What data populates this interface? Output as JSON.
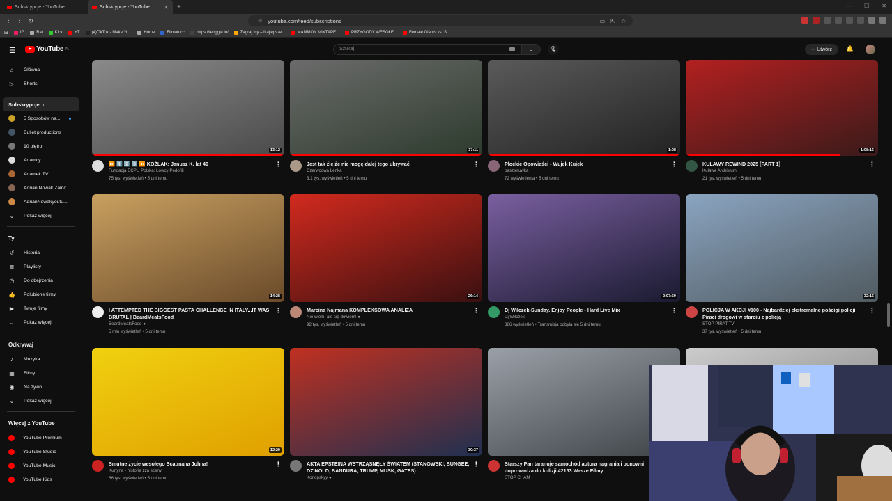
{
  "browser": {
    "tabs": [
      {
        "title": "Subskrypcje - YouTube",
        "active": false
      },
      {
        "title": "Subskrypcje - YouTube",
        "active": true
      }
    ],
    "url": "youtube.com/feed/subscriptions",
    "bookmarks": [
      "IG",
      "Rat",
      "Kick",
      "YT",
      "(4)TikTok - Make Yo...",
      "Home",
      "Filman.cc",
      "https://tenggle.io/",
      "Zagraj.my – Najlepsze...",
      "MAMMON MIXTAPE...",
      "PRZYGODY WESOŁE...",
      "Female Giants vs. St..."
    ]
  },
  "header": {
    "logo_text": "YouTube",
    "logo_sup": "PL",
    "search_placeholder": "Szukaj",
    "create_label": "Utwórz"
  },
  "sidebar": {
    "main": [
      {
        "label": "Główna",
        "icon": "home-icon"
      },
      {
        "label": "Shorts",
        "icon": "shorts-icon"
      }
    ],
    "subs_header": "Subskrypcje",
    "channels": [
      {
        "label": "5 Sposobów na...",
        "color": "#c9a227",
        "new": true
      },
      {
        "label": "Bullet productions",
        "color": "#445566",
        "new": false
      },
      {
        "label": "10 piętro",
        "color": "#777777",
        "new": false
      },
      {
        "label": "Adamcy",
        "color": "#dddddd",
        "new": false
      },
      {
        "label": "Adamek TV",
        "color": "#aa6633",
        "new": false
      },
      {
        "label": "Adrian Nowak Żałno",
        "color": "#886655",
        "new": false
      },
      {
        "label": "AdrianNowakyoutu...",
        "color": "#cc8844",
        "new": false
      }
    ],
    "more_label": "Pokaż więcej",
    "you_header": "Ty",
    "you": [
      {
        "label": "Historia",
        "icon": "history-icon"
      },
      {
        "label": "Playlisty",
        "icon": "playlist-icon"
      },
      {
        "label": "Do obejrzenia",
        "icon": "watch-later-icon"
      },
      {
        "label": "Polubione filmy",
        "icon": "like-icon"
      },
      {
        "label": "Twoje filmy",
        "icon": "your-videos-icon"
      },
      {
        "label": "Pokaż więcej",
        "icon": "chevron-down-icon"
      }
    ],
    "explore_header": "Odkrywaj",
    "explore": [
      {
        "label": "Muzyka",
        "icon": "music-icon"
      },
      {
        "label": "Filmy",
        "icon": "film-icon"
      },
      {
        "label": "Na żywo",
        "icon": "live-icon"
      },
      {
        "label": "Pokaż więcej",
        "icon": "chevron-down-icon"
      }
    ],
    "more_yt_header": "Więcej z YouTube",
    "more_yt": [
      {
        "label": "YouTube Premium"
      },
      {
        "label": "YouTube Studio"
      },
      {
        "label": "YouTube Music"
      },
      {
        "label": "YouTube Kids"
      }
    ]
  },
  "videos": [
    {
      "title": "⏩ 1️⃣ 2️⃣ 3️⃣ ⏪ KOŹLAK: Janusz K. lat 49",
      "channel": "Fundacja ECPU Polska: Łowcy Pedofili",
      "stats": "75 tys. wyświetleń • 5 dni temu",
      "duration": "13:12",
      "verified": false,
      "progress": 1.0,
      "colors": [
        "#8a8a8a",
        "#4a4a4a"
      ],
      "avatar": "#dddddd"
    },
    {
      "title": "Jest tak źle że nie mogę dalej tego ukrywać",
      "channel": "Czerwcowa Lenka",
      "stats": "3,1 tys. wyświetleń • 5 dni temu",
      "duration": "37:11",
      "verified": false,
      "progress": 1.0,
      "colors": [
        "#6b6b6b",
        "#2d3b2d"
      ],
      "avatar": "#aa9988"
    },
    {
      "title": "Płockie Opowieści - Wujek Kujek",
      "channel": "pasztetuwka",
      "stats": "72 wyświetlenia • 5 dni temu",
      "duration": "1:08",
      "verified": false,
      "progress": 1.0,
      "colors": [
        "#5a5a5a",
        "#222222"
      ],
      "avatar": "#886677"
    },
    {
      "title": "KULAWY REWIND 2025 [PART 1]",
      "channel": "Kulawe Archiwum",
      "stats": "21 tys. wyświetleń • 5 dni temu",
      "duration": "1:08:16",
      "verified": false,
      "progress": 0.8,
      "colors": [
        "#b32020",
        "#3a1a1a"
      ],
      "avatar": "#335544"
    },
    {
      "title": "I ATTEMPTED THE BIGGEST PASTA CHALLENGE IN ITALY...IT WAS BRUTAL | BeardMeatsFood",
      "channel": "BeardMeatsFood",
      "stats": "5 mln wyświetleń • 5 dni temu",
      "duration": "14:28",
      "verified": true,
      "progress": 0.0,
      "colors": [
        "#c8a060",
        "#6a4a2a"
      ],
      "avatar": "#eeeeee"
    },
    {
      "title": "Marcina Najmana KOMPLEKSOWA ANALIZA",
      "channel": "Nie wiem, ale się dowiem!",
      "stats": "92 tys. wyświetleń • 5 dni temu",
      "duration": "26:14",
      "verified": true,
      "progress": 0.0,
      "colors": [
        "#d22a1e",
        "#3a1010"
      ],
      "avatar": "#bb8877"
    },
    {
      "title": "Dj Wilczek-Sunday. Enjoy People - Hard Live Mix",
      "channel": "Dj Wilczek",
      "stats": "386 wyświetleń • Transmisja odbyła się 5 dni temu",
      "duration": "2:07:59",
      "verified": false,
      "progress": 0.0,
      "colors": [
        "#7a5fa0",
        "#1a1a30"
      ],
      "avatar": "#339966"
    },
    {
      "title": "POLICJA W AKCJI #100 - Najbardziej ekstremalne pościgi policji, Piraci drogowi w starciu z policją",
      "channel": "STOP PIRAT TV",
      "stats": "37 tys. wyświetleń • 5 dni temu",
      "duration": "32:16",
      "verified": false,
      "progress": 0.0,
      "colors": [
        "#8aa4c0",
        "#505a60"
      ],
      "avatar": "#cc4444"
    },
    {
      "title": "Smutne życie wesołego Scatmana Johna!",
      "channel": "Kurtyna - historie zza sceny",
      "stats": "66 tys. wyświetleń • 5 dni temu",
      "duration": "12:20",
      "verified": false,
      "progress": 0.0,
      "colors": [
        "#f0d010",
        "#e0a000"
      ],
      "avatar": "#cc2222"
    },
    {
      "title": "AKTA EPSTEINA WSTRZĄSNĘŁY ŚWIATEM (STANOWSKI, BUNGEE, DZINOLD, BANDURA, TRUMP, MUSK, GATES)",
      "channel": "Konopskyy",
      "stats": "",
      "duration": "30:37",
      "verified": true,
      "progress": 0.0,
      "colors": [
        "#c03020",
        "#203050"
      ],
      "avatar": "#777777"
    },
    {
      "title": "Starszy Pan taranuje samochód autora nagrania i ponowni doprowadza do kolizji #2153 Wasze Filmy",
      "channel": "STOP CHAM",
      "stats": "",
      "duration": "",
      "verified": false,
      "progress": 0.0,
      "colors": [
        "#9aa0a8",
        "#404448"
      ],
      "avatar": "#cc3333"
    },
    {
      "title": "",
      "channel": "",
      "stats": "",
      "duration": "",
      "verified": false,
      "progress": 0.0,
      "colors": [
        "#cccccc",
        "#777777"
      ],
      "avatar": "#000000"
    }
  ]
}
